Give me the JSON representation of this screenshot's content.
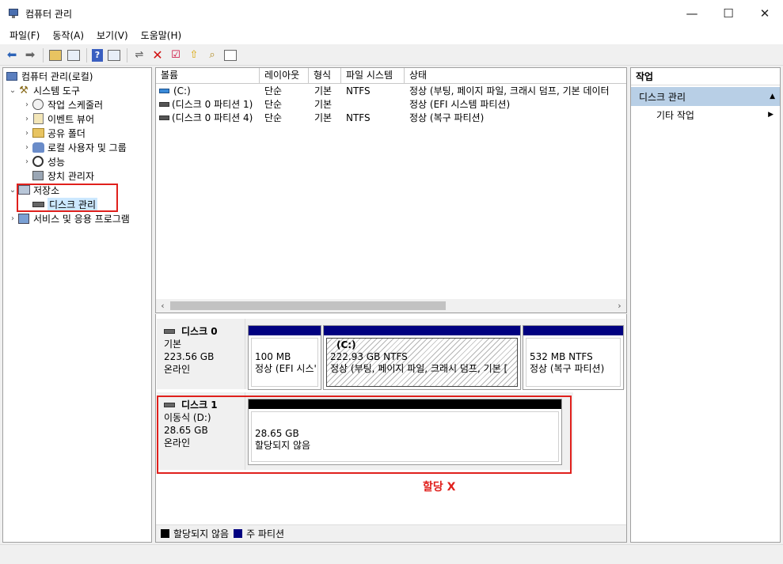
{
  "window": {
    "title": "컴퓨터 관리",
    "minimize": "—",
    "maximize": "☐",
    "close": "✕"
  },
  "menu": [
    "파일(F)",
    "동작(A)",
    "보기(V)",
    "도움말(H)"
  ],
  "tree": {
    "root": "컴퓨터 관리(로컬)",
    "system_tools": "시스템 도구",
    "task_scheduler": "작업 스케줄러",
    "event_viewer": "이벤트 뷰어",
    "shared_folders": "공유 폴더",
    "local_users": "로컬 사용자 및 그룹",
    "performance": "성능",
    "device_manager": "장치 관리자",
    "storage": "저장소",
    "disk_management": "디스크 관리",
    "services": "서비스 및 응용 프로그램"
  },
  "volume_table": {
    "columns": [
      "볼륨",
      "레이아웃",
      "형식",
      "파일 시스템",
      "상태"
    ],
    "rows": [
      {
        "volume": "(C:)",
        "layout": "단순",
        "type": "기본",
        "fs": "NTFS",
        "status": "정상 (부팅, 페이지 파일, 크래시 덤프, 기본 데이터"
      },
      {
        "volume": "(디스크 0 파티션 1)",
        "layout": "단순",
        "type": "기본",
        "fs": "",
        "status": "정상 (EFI 시스템 파티션)"
      },
      {
        "volume": "(디스크 0 파티션 4)",
        "layout": "단순",
        "type": "기본",
        "fs": "NTFS",
        "status": "정상 (복구 파티션)"
      }
    ]
  },
  "disks": {
    "disk0": {
      "name": "디스크 0",
      "type": "기본",
      "size": "223.56 GB",
      "state": "온라인",
      "partitions": [
        {
          "label": "",
          "size": "100 MB",
          "status": "정상 (EFI 시스'"
        },
        {
          "label": "(C:)",
          "size": "222.93 GB NTFS",
          "status": "정상 (부팅, 페이지 파일, 크래시 덤프, 기본 ["
        },
        {
          "label": "",
          "size": "532 MB NTFS",
          "status": "정상 (복구 파티션)"
        }
      ]
    },
    "disk1": {
      "name": "디스크 1",
      "type": "이동식 (D:)",
      "size": "28.65 GB",
      "state": "온라인",
      "partitions": [
        {
          "size": "28.65 GB",
          "status": "할당되지 않음"
        }
      ]
    }
  },
  "legend": {
    "unallocated": "할당되지 않음",
    "primary": "주 파티션"
  },
  "annotation": "할당 X",
  "actions": {
    "header": "작업",
    "section": "디스크 관리",
    "more": "기타 작업"
  },
  "colors": {
    "primary": "#000080",
    "unallocated": "#000000",
    "highlight_red": "#e0201c",
    "selection": "#cce8ff",
    "action_section": "#b8cfe6"
  }
}
